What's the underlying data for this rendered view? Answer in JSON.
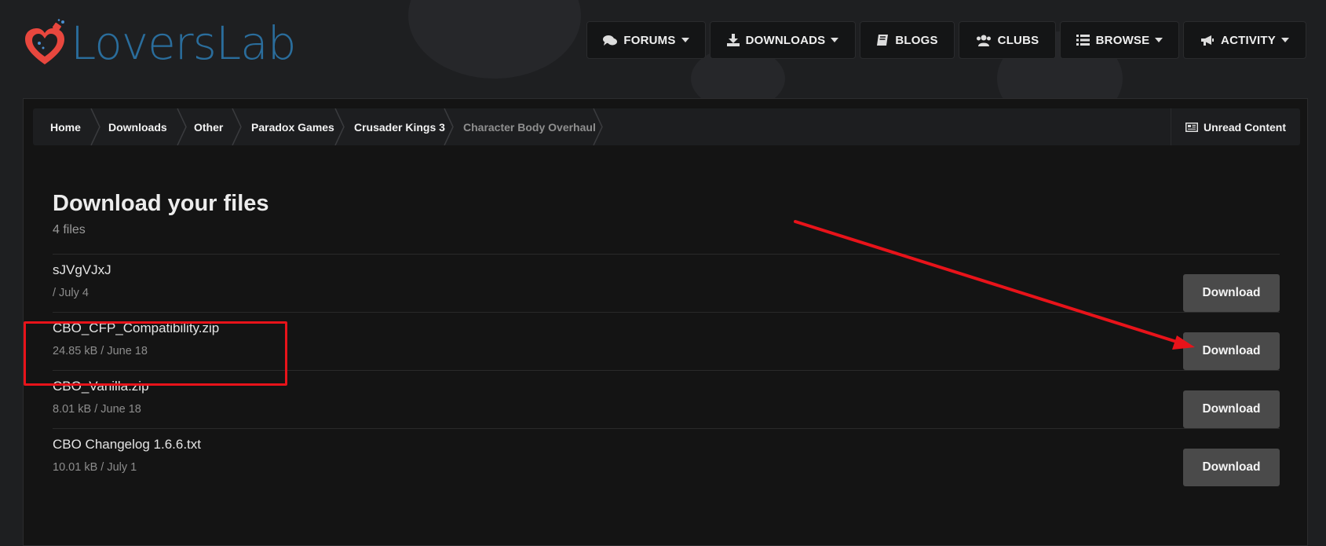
{
  "site": {
    "name": "LoversLab"
  },
  "nav": [
    {
      "label": "FORUMS",
      "icon": "comments-icon",
      "dropdown": true
    },
    {
      "label": "DOWNLOADS",
      "icon": "download-icon",
      "dropdown": true
    },
    {
      "label": "BLOGS",
      "icon": "book-icon",
      "dropdown": false
    },
    {
      "label": "CLUBS",
      "icon": "users-icon",
      "dropdown": false
    },
    {
      "label": "BROWSE",
      "icon": "list-icon",
      "dropdown": true
    },
    {
      "label": "ACTIVITY",
      "icon": "bullhorn-icon",
      "dropdown": true
    }
  ],
  "breadcrumb": {
    "items": [
      "Home",
      "Downloads",
      "Other",
      "Paradox Games",
      "Crusader Kings 3",
      "Character Body Overhaul"
    ],
    "unread_label": "Unread Content"
  },
  "main": {
    "title": "Download your files",
    "file_count": "4 files",
    "download_label": "Download",
    "files": [
      {
        "name": "sJVgVJxJ",
        "meta": "/ July 4"
      },
      {
        "name": "CBO_CFP_Compatibility.zip",
        "meta": "24.85 kB / June 18"
      },
      {
        "name": "CBO_Vanilla.zip",
        "meta": "8.01 kB / June 18"
      },
      {
        "name": "CBO Changelog 1.6.6.txt",
        "meta": "10.01 kB / July 1"
      }
    ]
  },
  "annotation_color": "#e8131a",
  "accent_color": "#2a6d9c"
}
